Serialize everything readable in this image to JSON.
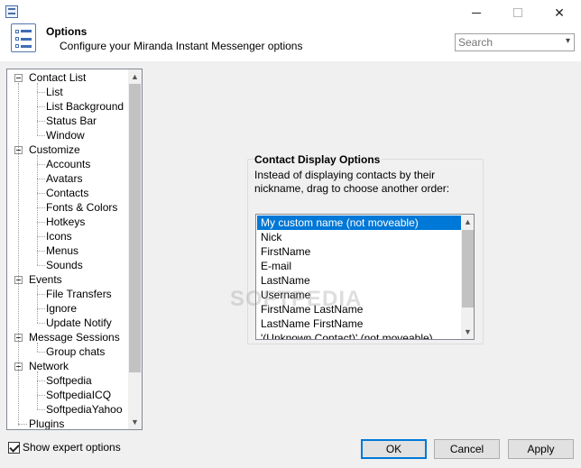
{
  "window": {
    "close_glyph": "✕"
  },
  "header": {
    "title": "Options",
    "subtitle": "Configure your Miranda Instant Messenger options",
    "search_placeholder": "Search"
  },
  "tree": {
    "items": [
      {
        "label": "Contact List",
        "level": 0,
        "expanded": true
      },
      {
        "label": "List",
        "level": 1
      },
      {
        "label": "List Background",
        "level": 1
      },
      {
        "label": "Status Bar",
        "level": 1
      },
      {
        "label": "Window",
        "level": 1
      },
      {
        "label": "Customize",
        "level": 0,
        "expanded": true
      },
      {
        "label": "Accounts",
        "level": 1
      },
      {
        "label": "Avatars",
        "level": 1
      },
      {
        "label": "Contacts",
        "level": 1,
        "selected": true
      },
      {
        "label": "Fonts & Colors",
        "level": 1
      },
      {
        "label": "Hotkeys",
        "level": 1
      },
      {
        "label": "Icons",
        "level": 1
      },
      {
        "label": "Menus",
        "level": 1
      },
      {
        "label": "Sounds",
        "level": 1
      },
      {
        "label": "Events",
        "level": 0,
        "expanded": true
      },
      {
        "label": "File Transfers",
        "level": 1
      },
      {
        "label": "Ignore",
        "level": 1
      },
      {
        "label": "Update Notify",
        "level": 1
      },
      {
        "label": "Message Sessions",
        "level": 0,
        "expanded": true
      },
      {
        "label": "Group chats",
        "level": 1
      },
      {
        "label": "Network",
        "level": 0,
        "expanded": true
      },
      {
        "label": "Softpedia",
        "level": 1
      },
      {
        "label": "SoftpediaICQ",
        "level": 1
      },
      {
        "label": "SoftpediaYahoo",
        "level": 1
      },
      {
        "label": "Plugins",
        "level": 0
      }
    ]
  },
  "panel": {
    "title": "Contact Display Options",
    "description": "Instead of displaying contacts by their nickname, drag to choose another order:",
    "order_list": [
      "My custom name (not moveable)",
      "Nick",
      "FirstName",
      "E-mail",
      "LastName",
      "Username",
      "FirstName LastName",
      "LastName FirstName",
      "'(Unknown Contact)' (not moveable)"
    ],
    "selected_index": 0
  },
  "watermark": "SOFTPEDIA",
  "footer": {
    "expert_label": "Show expert options",
    "expert_checked": true,
    "ok_label": "OK",
    "cancel_label": "Cancel",
    "apply_label": "Apply"
  },
  "colors": {
    "selection": "#0078d7",
    "default_button_border": "#0078d7"
  }
}
